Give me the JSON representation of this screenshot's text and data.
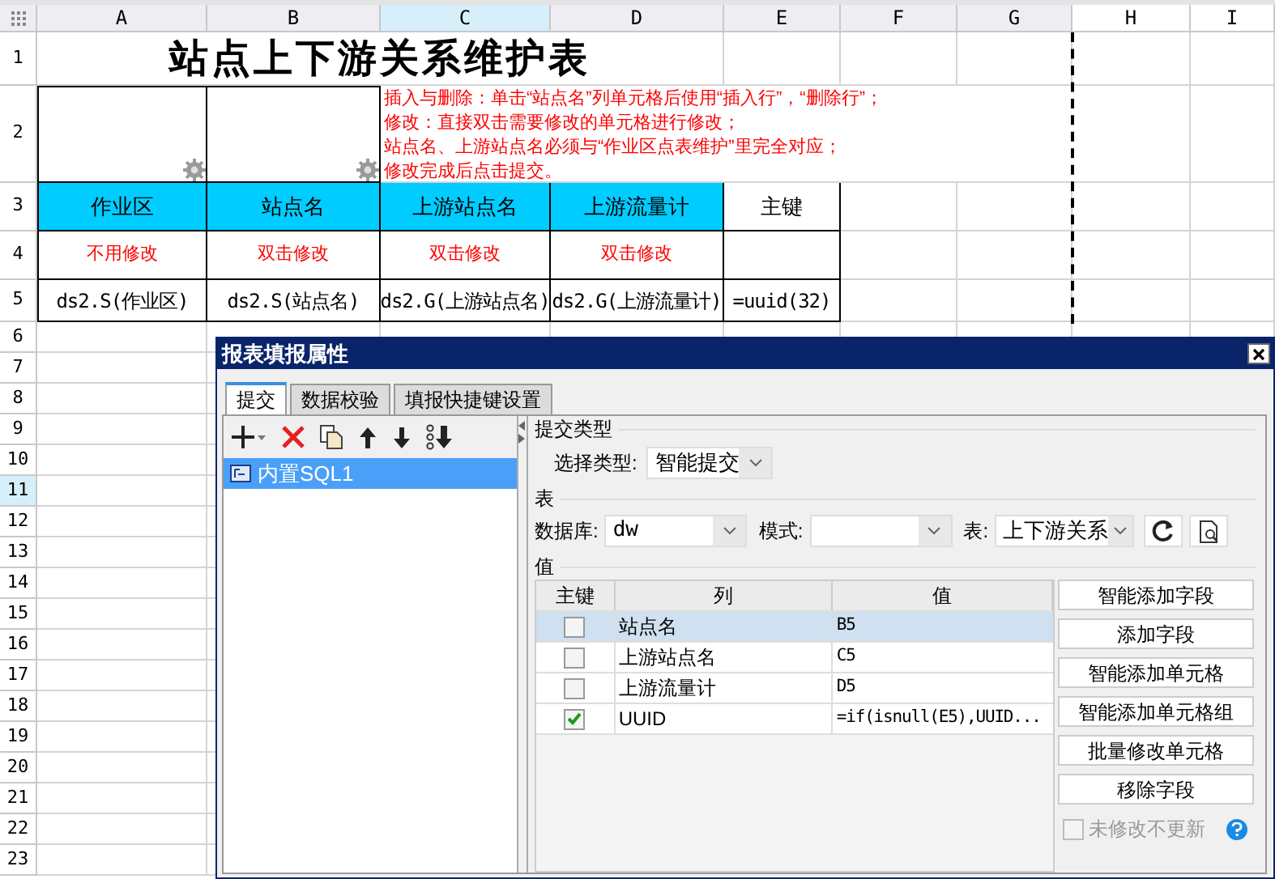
{
  "sheet": {
    "columns": [
      {
        "label": "A",
        "selected": false
      },
      {
        "label": "B",
        "selected": false
      },
      {
        "label": "C",
        "selected": true
      },
      {
        "label": "D",
        "selected": false
      },
      {
        "label": "E",
        "selected": false
      },
      {
        "label": "F",
        "selected": false
      },
      {
        "label": "G",
        "selected": false
      },
      {
        "label": "H",
        "selected": false
      },
      {
        "label": "I",
        "selected": false
      }
    ],
    "rows": [
      {
        "label": "1",
        "selected": false
      },
      {
        "label": "2",
        "selected": false
      },
      {
        "label": "3",
        "selected": false
      },
      {
        "label": "4",
        "selected": false
      },
      {
        "label": "5",
        "selected": false
      },
      {
        "label": "6",
        "selected": false
      },
      {
        "label": "7",
        "selected": false
      },
      {
        "label": "8",
        "selected": false
      },
      {
        "label": "9",
        "selected": false
      },
      {
        "label": "10",
        "selected": false
      },
      {
        "label": "11",
        "selected": true
      },
      {
        "label": "12",
        "selected": false
      },
      {
        "label": "13",
        "selected": false
      },
      {
        "label": "14",
        "selected": false
      },
      {
        "label": "15",
        "selected": false
      },
      {
        "label": "16",
        "selected": false
      },
      {
        "label": "17",
        "selected": false
      },
      {
        "label": "18",
        "selected": false
      },
      {
        "label": "19",
        "selected": false
      },
      {
        "label": "20",
        "selected": false
      },
      {
        "label": "21",
        "selected": false
      },
      {
        "label": "22",
        "selected": false
      },
      {
        "label": "23",
        "selected": false
      }
    ],
    "title": "站点上下游关系维护表",
    "instructions": [
      "插入与删除：单击“站点名”列单元格后使用“插入行”，“删除行”；",
      "修改：直接双击需要修改的单元格进行修改；",
      "站点名、上游站点名必须与“作业区点表维护”里完全对应；",
      "修改完成后点击提交。"
    ],
    "headers": [
      {
        "text": "作业区",
        "color": "#00ccff"
      },
      {
        "text": "站点名",
        "color": "#00ccff"
      },
      {
        "text": "上游站点名",
        "color": "#00ccff"
      },
      {
        "text": "上游流量计",
        "color": "#00ccff"
      },
      {
        "text": "主键",
        "color": "#ffffff"
      }
    ],
    "notes": [
      "不用修改",
      "双击修改",
      "双击修改",
      "双击修改"
    ],
    "bindings": [
      "ds2.S(作业区)",
      "ds2.S(站点名)",
      "ds2.G(上游站点名)",
      "ds2.G(上游流量计)",
      "=uuid(32)"
    ]
  },
  "dialog": {
    "title": "报表填报属性",
    "tabs": [
      {
        "label": "提交",
        "selected": true
      },
      {
        "label": "数据校验",
        "selected": false
      },
      {
        "label": "填报快捷键设置",
        "selected": false
      }
    ],
    "submissions": [
      {
        "label": "内置SQL1",
        "selected": true
      }
    ],
    "submit_type": {
      "section": "提交类型",
      "label": "选择类型:",
      "value": "智能提交"
    },
    "table_section": "表",
    "database": {
      "label": "数据库:",
      "value": "dw"
    },
    "schema": {
      "label": "模式:"
    },
    "table": {
      "label": "表:",
      "value": "上下游关系"
    },
    "values_section": "值",
    "value_columns": [
      "主键",
      "列",
      "值"
    ],
    "value_rows": [
      {
        "checked": false,
        "column": "站点名",
        "value": "B5",
        "selected": true
      },
      {
        "checked": false,
        "column": "上游站点名",
        "value": "C5",
        "selected": false
      },
      {
        "checked": false,
        "column": "上游流量计",
        "value": "D5",
        "selected": false
      },
      {
        "checked": true,
        "column": "UUID",
        "value": "=if(isnull(E5),UUID...",
        "selected": false
      }
    ],
    "buttons": [
      "智能添加字段",
      "添加字段",
      "智能添加单元格",
      "智能添加单元格组",
      "批量修改单元格",
      "移除字段"
    ],
    "skip_unchanged": {
      "label": "未修改不更新",
      "checked": false,
      "disabled": true
    }
  }
}
